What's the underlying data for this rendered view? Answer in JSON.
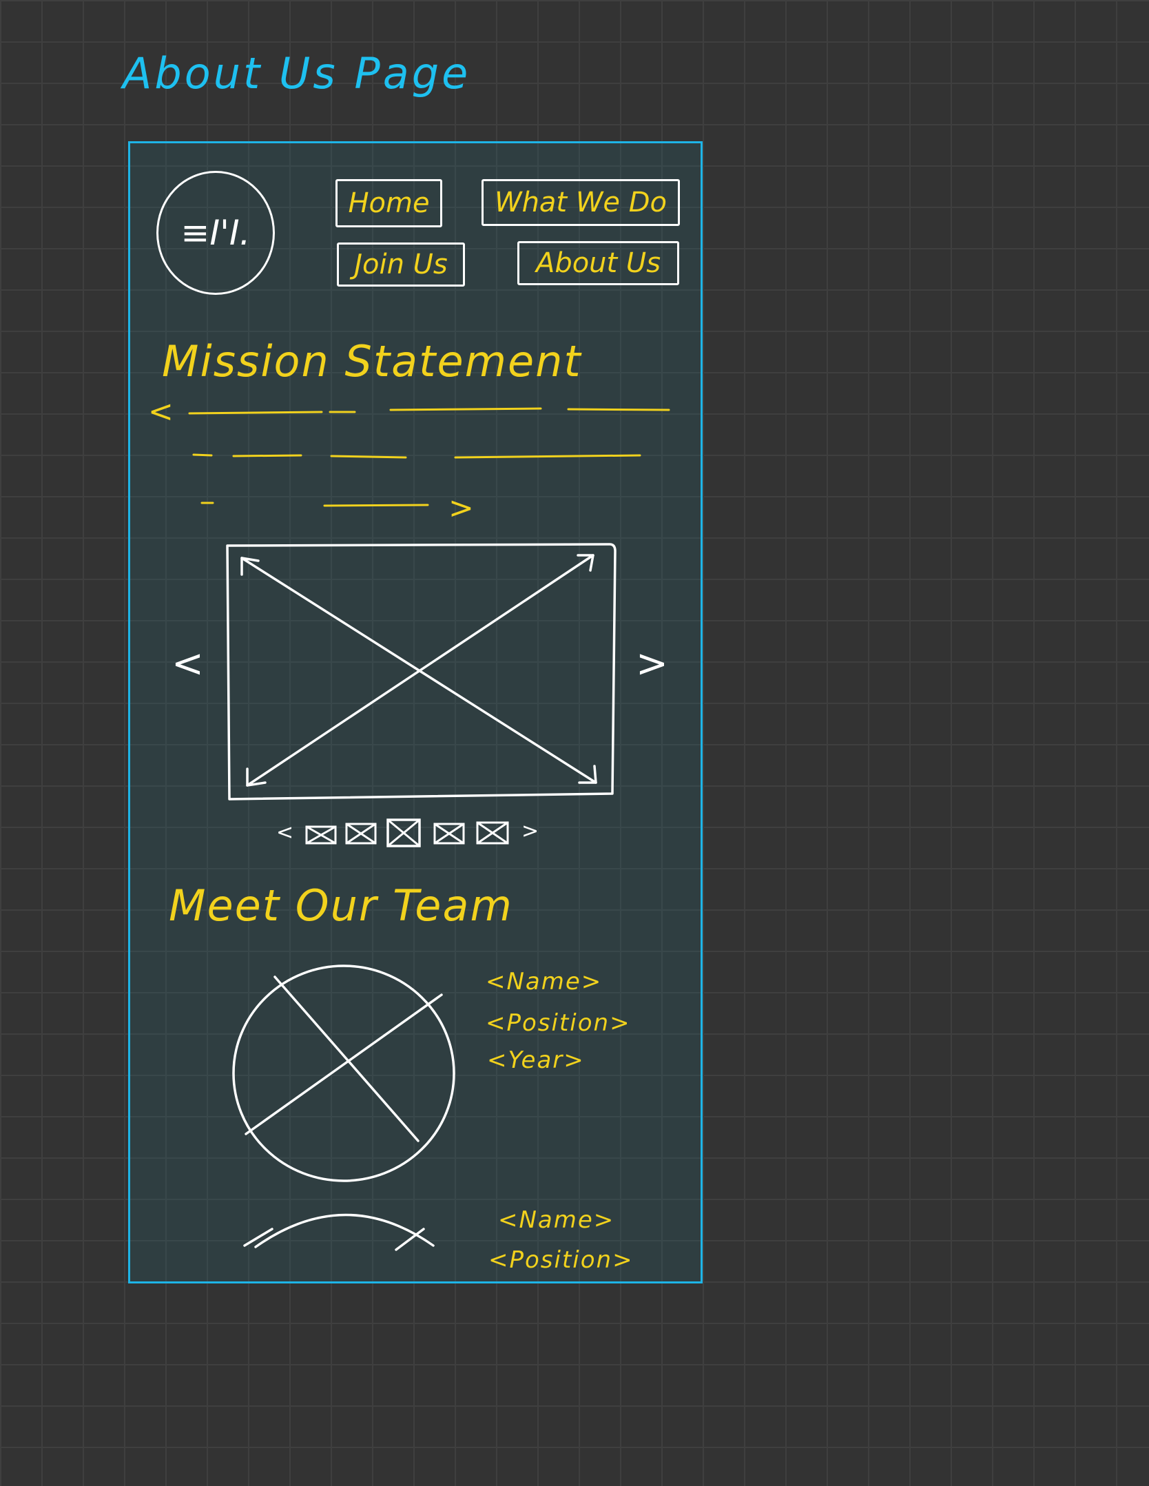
{
  "page_title": "About Us Page",
  "header": {
    "logo_text": "≡I'I.",
    "nav": [
      {
        "label": "Home"
      },
      {
        "label": "What We Do"
      },
      {
        "label": "Join Us"
      },
      {
        "label": "About Us"
      }
    ]
  },
  "mission": {
    "heading": "Mission Statement",
    "open_caret": "<",
    "close_caret": ">"
  },
  "carousel": {
    "prev": "<",
    "next": ">",
    "thumb_prev": "<",
    "thumb_next": ">",
    "thumbnail_count": 5,
    "active_thumbnail": 3
  },
  "team": {
    "heading": "Meet Our Team",
    "members": [
      {
        "name": "<Name>",
        "position": "<Position>",
        "year": "<Year>"
      },
      {
        "name": "<Name>",
        "position": "<Position>"
      }
    ]
  },
  "colors": {
    "canvas": "#333333",
    "grid": "#3f3f3f",
    "title_blue": "#1ec0f0",
    "frame_blue": "#1eb4e6",
    "text_yellow": "#f2d21d",
    "sketch_white": "#ffffff"
  }
}
